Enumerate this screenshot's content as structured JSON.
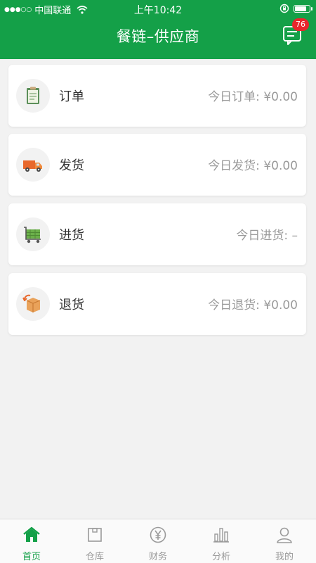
{
  "status_bar": {
    "carrier": "中国联通",
    "time": "上午10:42"
  },
  "header": {
    "title": "餐链–供应商",
    "message_badge": "76"
  },
  "cards": [
    {
      "label": "订单",
      "stat": "今日订单: ¥0.00",
      "icon": "clipboard-icon"
    },
    {
      "label": "发货",
      "stat": "今日发货: ¥0.00",
      "icon": "truck-icon"
    },
    {
      "label": "进货",
      "stat": "今日进货: –",
      "icon": "cart-icon"
    },
    {
      "label": "退货",
      "stat": "今日退货: ¥0.00",
      "icon": "return-box-icon"
    }
  ],
  "tabbar": {
    "items": [
      {
        "label": "首页",
        "icon": "home-icon",
        "active": true
      },
      {
        "label": "仓库",
        "icon": "warehouse-icon",
        "active": false
      },
      {
        "label": "财务",
        "icon": "yen-icon",
        "active": false
      },
      {
        "label": "分析",
        "icon": "bar-chart-icon",
        "active": false
      },
      {
        "label": "我的",
        "icon": "user-icon",
        "active": false
      }
    ]
  },
  "colors": {
    "brand": "#14a048",
    "badge": "#e8262c",
    "background": "#f2f2f2"
  }
}
